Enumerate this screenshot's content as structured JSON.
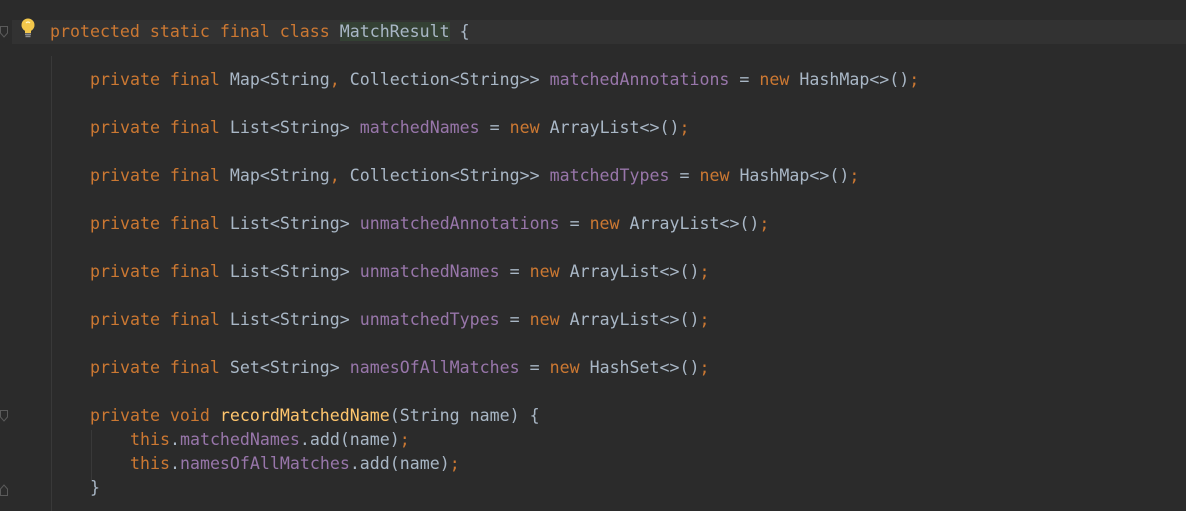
{
  "code": {
    "class_decl": {
      "modifiers": "protected static final class",
      "name": "MatchResult",
      "open": " {"
    },
    "fields": [
      {
        "kw": "private final",
        "type": "Map<String",
        "comma": ",",
        "type2": " Collection<String>>",
        "name": "matchedAnnotations",
        "eq": " = ",
        "new": "new",
        "ctor": " HashMap<>()",
        "semi": ";"
      },
      {
        "kw": "private final",
        "type": "List<String>",
        "comma": "",
        "type2": "",
        "name": "matchedNames",
        "eq": " = ",
        "new": "new",
        "ctor": " ArrayList<>()",
        "semi": ";"
      },
      {
        "kw": "private final",
        "type": "Map<String",
        "comma": ",",
        "type2": " Collection<String>>",
        "name": "matchedTypes",
        "eq": " = ",
        "new": "new",
        "ctor": " HashMap<>()",
        "semi": ";"
      },
      {
        "kw": "private final",
        "type": "List<String>",
        "comma": "",
        "type2": "",
        "name": "unmatchedAnnotations",
        "eq": " = ",
        "new": "new",
        "ctor": " ArrayList<>()",
        "semi": ";"
      },
      {
        "kw": "private final",
        "type": "List<String>",
        "comma": "",
        "type2": "",
        "name": "unmatchedNames",
        "eq": " = ",
        "new": "new",
        "ctor": " ArrayList<>()",
        "semi": ";"
      },
      {
        "kw": "private final",
        "type": "List<String>",
        "comma": "",
        "type2": "",
        "name": "unmatchedTypes",
        "eq": " = ",
        "new": "new",
        "ctor": " ArrayList<>()",
        "semi": ";"
      },
      {
        "kw": "private final",
        "type": "Set<String>",
        "comma": "",
        "type2": "",
        "name": "namesOfAllMatches",
        "eq": " = ",
        "new": "new",
        "ctor": " HashSet<>()",
        "semi": ";"
      }
    ],
    "method": {
      "kw": "private void",
      "name": "recordMatchedName",
      "params": "(String name) {",
      "body": [
        {
          "this": "this",
          "dot": ".",
          "field": "matchedNames",
          "call": ".add(name)",
          "semi": ";"
        },
        {
          "this": "this",
          "dot": ".",
          "field": "namesOfAllMatches",
          "call": ".add(name)",
          "semi": ";"
        }
      ],
      "close": "}"
    }
  },
  "colors": {
    "background": "#2b2b2b",
    "keyword": "#cc7832",
    "field": "#9876aa",
    "method": "#ffc66d",
    "plain": "#a9b7c6"
  },
  "icons": [
    "lightbulb-icon",
    "fold-marker-icon"
  ]
}
